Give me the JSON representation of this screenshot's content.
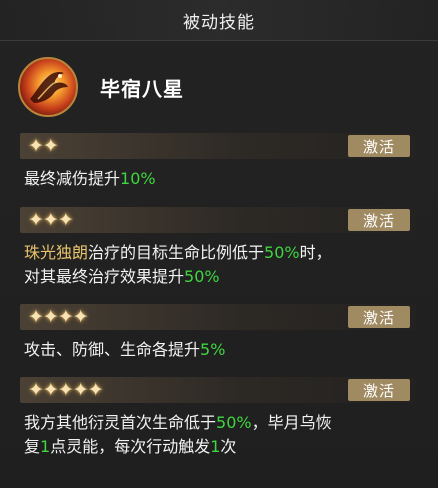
{
  "header": {
    "title": "被动技能"
  },
  "skill": {
    "name": "毕宿八星",
    "icon": "phoenix-fire-icon"
  },
  "colors": {
    "highlight_green": "#3fd63f",
    "highlight_gold": "#e8c36a",
    "badge_bg": "#a08a62"
  },
  "tiers": [
    {
      "stars": 2,
      "badge": "激活",
      "desc": [
        {
          "t": "最终减伤提升",
          "c": "w"
        },
        {
          "t": "10%",
          "c": "g"
        }
      ]
    },
    {
      "stars": 3,
      "badge": "激活",
      "desc": [
        {
          "t": "珠光独朗",
          "c": "y"
        },
        {
          "t": "治疗的目标生命比例低于",
          "c": "w"
        },
        {
          "t": "50%",
          "c": "g"
        },
        {
          "t": "时，",
          "c": "w"
        }
      ],
      "desc2": [
        {
          "t": "对其最终治疗效果提升",
          "c": "w"
        },
        {
          "t": "50%",
          "c": "g"
        }
      ]
    },
    {
      "stars": 4,
      "badge": "激活",
      "desc": [
        {
          "t": "攻击、防御、生命各提升",
          "c": "w"
        },
        {
          "t": "5%",
          "c": "g"
        }
      ]
    },
    {
      "stars": 5,
      "badge": "激活",
      "desc": [
        {
          "t": "我方其他衍灵首次生命低于",
          "c": "w"
        },
        {
          "t": "50%",
          "c": "g"
        },
        {
          "t": "，毕月乌恢",
          "c": "w"
        }
      ],
      "desc2": [
        {
          "t": "复",
          "c": "w"
        },
        {
          "t": "1",
          "c": "g"
        },
        {
          "t": "点灵能，每次行动触发",
          "c": "w"
        },
        {
          "t": "1",
          "c": "g"
        },
        {
          "t": "次",
          "c": "w"
        }
      ]
    }
  ]
}
